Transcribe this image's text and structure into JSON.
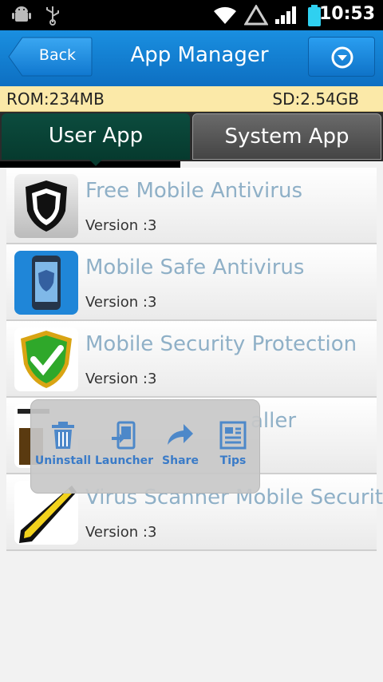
{
  "status": {
    "time": "10:53"
  },
  "header": {
    "back_label": "Back",
    "title": "App Manager"
  },
  "storage": {
    "rom": "ROM:234MB",
    "sd": "SD:2.54GB"
  },
  "tabs": [
    {
      "label": "User App",
      "selected": true
    },
    {
      "label": "System App",
      "selected": false
    }
  ],
  "apps": [
    {
      "name": "Free Mobile Antivirus",
      "version": "Version :3"
    },
    {
      "name": "Mobile Safe Antivirus",
      "version": "Version :3"
    },
    {
      "name": "Mobile Security Protection",
      "version": "Version :3"
    },
    {
      "name": "aller",
      "version": ""
    },
    {
      "name": "Virus Scanner Mobile Security",
      "version": "Version :3"
    }
  ],
  "popup": {
    "uninstall": "Uninstall",
    "launcher": "Launcher",
    "share": "Share",
    "tips": "Tips"
  },
  "colors": {
    "header_blue": "#1a8fe0",
    "tab_selected": "#0c4c3e",
    "storage_bg": "#fbe9a8",
    "app_name": "#8fb0c7",
    "popup_label": "#3a7bc8"
  }
}
